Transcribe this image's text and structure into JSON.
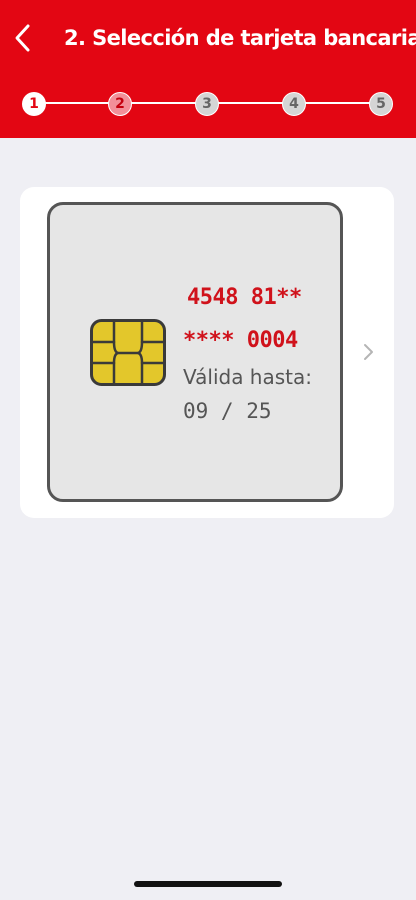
{
  "header": {
    "title": "2. Selección de tarjeta bancaria",
    "back_icon": "chevron-left-icon",
    "background_color": "#e30613"
  },
  "steps": [
    {
      "label": "1",
      "state": "current"
    },
    {
      "label": "2",
      "state": "active"
    },
    {
      "label": "3",
      "state": "pending"
    },
    {
      "label": "4",
      "state": "pending"
    },
    {
      "label": "5",
      "state": "pending"
    }
  ],
  "card": {
    "number_line1": "4548 81**",
    "number_line2": "**** 0004",
    "valid_label": "Válida hasta:",
    "valid_date": "09 / 25",
    "chip_icon": "card-chip-icon",
    "next_icon": "chevron-right-icon",
    "number_color": "#d0121b"
  }
}
